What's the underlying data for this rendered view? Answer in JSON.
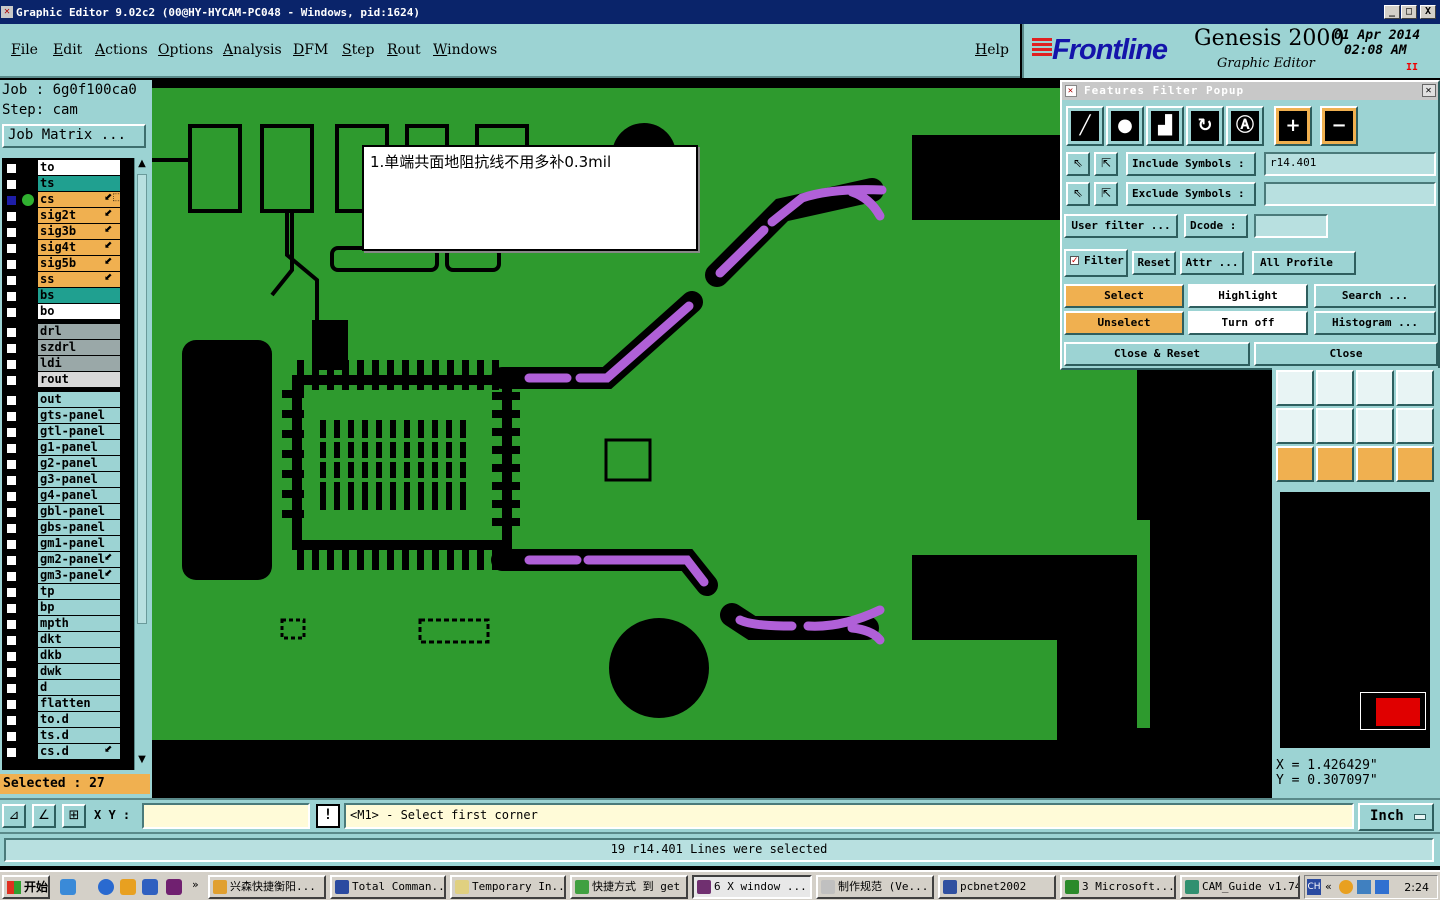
{
  "titlebar": {
    "title": "Graphic Editor 9.02c2 (00@HY-HYCAM-PC048 - Windows, pid:1624)",
    "min": "_",
    "max": "□",
    "close": "X"
  },
  "menu": [
    "File",
    "Edit",
    "Actions",
    "Options",
    "Analysis",
    "DFM",
    "Step",
    "Rout",
    "Windows"
  ],
  "help": "Help",
  "logo": {
    "brand": "Frontline",
    "product": "Genesis 2000",
    "subtitle": "Graphic Editor",
    "date": "01 Apr 2014",
    "time": "02:08 AM",
    "pause": "II"
  },
  "job": {
    "job_line": "Job : 6g0f100ca0",
    "step_line": "Step: cam",
    "matrix_button": "Job Matrix ..."
  },
  "layers": [
    {
      "name": "to",
      "color": "#ffffff",
      "checked": false,
      "arrow": ""
    },
    {
      "name": "ts",
      "color": "#20a090",
      "checked": false,
      "arrow": ""
    },
    {
      "name": "cs",
      "color": "#f0b050",
      "checked": true,
      "arrow": "⬋⬚"
    },
    {
      "name": "sig2t",
      "color": "#f0b050",
      "checked": false,
      "arrow": "⬋"
    },
    {
      "name": "sig3b",
      "color": "#f0b050",
      "checked": false,
      "arrow": "⬋"
    },
    {
      "name": "sig4t",
      "color": "#f0b050",
      "checked": false,
      "arrow": "⬋"
    },
    {
      "name": "sig5b",
      "color": "#f0b050",
      "checked": false,
      "arrow": "⬋"
    },
    {
      "name": "ss",
      "color": "#f0b050",
      "checked": false,
      "arrow": "⬋"
    },
    {
      "name": "bs",
      "color": "#20a090",
      "checked": false,
      "arrow": ""
    },
    {
      "name": "bo",
      "color": "#ffffff",
      "checked": false,
      "arrow": ""
    },
    {
      "name": "drl",
      "color": "#9aa8a8",
      "checked": false,
      "arrow": ""
    },
    {
      "name": "szdrl",
      "color": "#9aa8a8",
      "checked": false,
      "arrow": ""
    },
    {
      "name": "ldi",
      "color": "#9aa8a8",
      "checked": false,
      "arrow": ""
    },
    {
      "name": "rout",
      "color": "#d8d8d8",
      "checked": false,
      "arrow": ""
    },
    {
      "name": "out",
      "color": "#9cd3d3",
      "checked": false,
      "arrow": ""
    },
    {
      "name": "gts-panel",
      "color": "#9cd3d3",
      "checked": false,
      "arrow": ""
    },
    {
      "name": "gtl-panel",
      "color": "#9cd3d3",
      "checked": false,
      "arrow": ""
    },
    {
      "name": "g1-panel",
      "color": "#9cd3d3",
      "checked": false,
      "arrow": ""
    },
    {
      "name": "g2-panel",
      "color": "#9cd3d3",
      "checked": false,
      "arrow": ""
    },
    {
      "name": "g3-panel",
      "color": "#9cd3d3",
      "checked": false,
      "arrow": ""
    },
    {
      "name": "g4-panel",
      "color": "#9cd3d3",
      "checked": false,
      "arrow": ""
    },
    {
      "name": "gbl-panel",
      "color": "#9cd3d3",
      "checked": false,
      "arrow": ""
    },
    {
      "name": "gbs-panel",
      "color": "#9cd3d3",
      "checked": false,
      "arrow": ""
    },
    {
      "name": "gm1-panel",
      "color": "#9cd3d3",
      "checked": false,
      "arrow": ""
    },
    {
      "name": "gm2-panel",
      "color": "#9cd3d3",
      "checked": false,
      "arrow": "⬋"
    },
    {
      "name": "gm3-panel",
      "color": "#9cd3d3",
      "checked": false,
      "arrow": "⬋"
    },
    {
      "name": "tp",
      "color": "#9cd3d3",
      "checked": false,
      "arrow": ""
    },
    {
      "name": "bp",
      "color": "#9cd3d3",
      "checked": false,
      "arrow": ""
    },
    {
      "name": "mpth",
      "color": "#9cd3d3",
      "checked": false,
      "arrow": ""
    },
    {
      "name": "dkt",
      "color": "#9cd3d3",
      "checked": false,
      "arrow": ""
    },
    {
      "name": "dkb",
      "color": "#9cd3d3",
      "checked": false,
      "arrow": ""
    },
    {
      "name": "dwk",
      "color": "#9cd3d3",
      "checked": false,
      "arrow": ""
    },
    {
      "name": "d",
      "color": "#9cd3d3",
      "checked": false,
      "arrow": ""
    },
    {
      "name": "flatten",
      "color": "#9cd3d3",
      "checked": false,
      "arrow": ""
    },
    {
      "name": "to.d",
      "color": "#9cd3d3",
      "checked": false,
      "arrow": ""
    },
    {
      "name": "ts.d",
      "color": "#9cd3d3",
      "checked": false,
      "arrow": ""
    },
    {
      "name": "cs.d",
      "color": "#9cd3d3",
      "checked": false,
      "arrow": "⬋"
    }
  ],
  "selected": "Selected : 27",
  "note": "1.单端共面地阻抗线不用多补0.3mil",
  "filter_popup": {
    "title": "Features Filter Popup",
    "include_label": "Include Symbols :",
    "include_value": "r14.401",
    "exclude_label": "Exclude Symbols :",
    "exclude_value": "",
    "user_filter": "User filter ...",
    "dcode_label": "Dcode :",
    "dcode_value": "",
    "filter": "Filter",
    "reset": "Reset",
    "attr": "Attr ...",
    "profile": "All Profile",
    "select": "Select",
    "highlight": "Highlight",
    "search": "Search ...",
    "unselect": "Unselect",
    "turn_off": "Turn off",
    "histogram": "Histogram ...",
    "close_reset": "Close & Reset",
    "close": "Close"
  },
  "coords": {
    "x": "X = 1.426429\"",
    "y": "Y = 0.307097\""
  },
  "status": {
    "xy_label": "X Y :",
    "xy_value": "",
    "bang": "!",
    "prompt": "<M1> - Select first corner",
    "units": "Inch",
    "message": "19 r14.401 Lines were selected"
  },
  "taskbar": {
    "start": "开始",
    "tasks": [
      "兴森快捷衡阳...",
      "Total Comman...",
      "Temporary In...",
      "快捷方式 到 get",
      "6 X window ...",
      "制作规范 (Ve...",
      "pcbnet2002",
      "3 Microsoft...",
      "CAM_Guide v1.74"
    ],
    "ime": "CH",
    "clock": "2:24"
  },
  "colors": {
    "board": "#2e9a2e",
    "selected_trace": "#b060d8",
    "panel": "#9cd3d3"
  }
}
